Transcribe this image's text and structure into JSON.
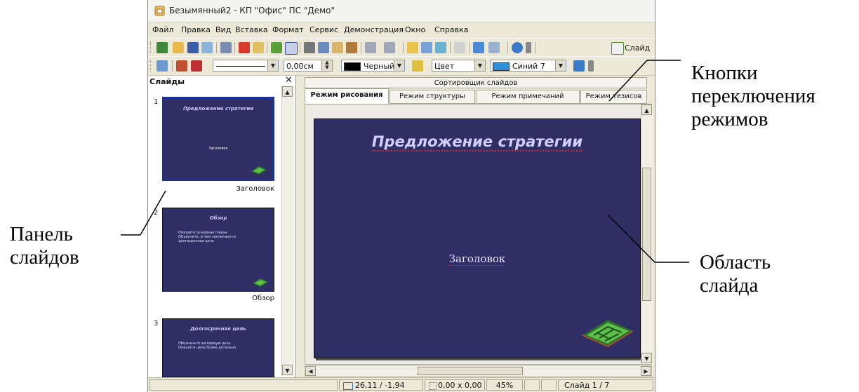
{
  "window": {
    "title": "Безымянный2 - КП \"Офис\" ПС \"Демо\""
  },
  "menu": [
    "Файл",
    "Правка",
    "Вид",
    "Вставка",
    "Формат",
    "Сервис",
    "Демонстрация",
    "Окно",
    "Справка"
  ],
  "toolbar1": {
    "slide_button_label": "Слайд"
  },
  "toolbar2": {
    "line_width": "0,00см",
    "line_color_label": "Черный",
    "area_style_label": "Цвет",
    "fill_color_label": "Синий 7",
    "colors": {
      "line": "#000000",
      "fill": "#2f8fd8"
    }
  },
  "slides_panel": {
    "title": "Слайды",
    "close": "✕",
    "slides": [
      {
        "number": "1",
        "title": "Предложение стратегии",
        "subtitle": "Заголовок",
        "label": "Заголовок"
      },
      {
        "number": "2",
        "title": "Обзор",
        "bullets": [
          "Опишите основные планы",
          "Объясните, в чем заключается долгосрочная цель"
        ],
        "label": "Обзор"
      },
      {
        "number": "3",
        "title": "Долгосрочная цель",
        "bullets": [
          "Обозначьте желаемую цель",
          "Опишите цель более детально"
        ],
        "label": ""
      }
    ]
  },
  "tabs": {
    "sorter": "Сортировщик слайдов",
    "items": [
      "Режим рисования",
      "Режим структуры",
      "Режим примечаний",
      "Режим тезисов"
    ],
    "active": "Режим рисования"
  },
  "slide": {
    "title": "Предложение стратегии",
    "subtitle": "Заголовок",
    "background": "#2f2f66"
  },
  "status": {
    "position": "26,11 / -1,94",
    "size": "0,00 x 0,00",
    "zoom": "45%",
    "slide": "Слайд 1 / 7"
  },
  "annotations": {
    "mode_buttons": [
      "Кнопки",
      "переключения",
      "режимов"
    ],
    "slides_panel": [
      "Панель",
      "слайдов"
    ],
    "slide_area": [
      "Область",
      "слайда"
    ]
  }
}
